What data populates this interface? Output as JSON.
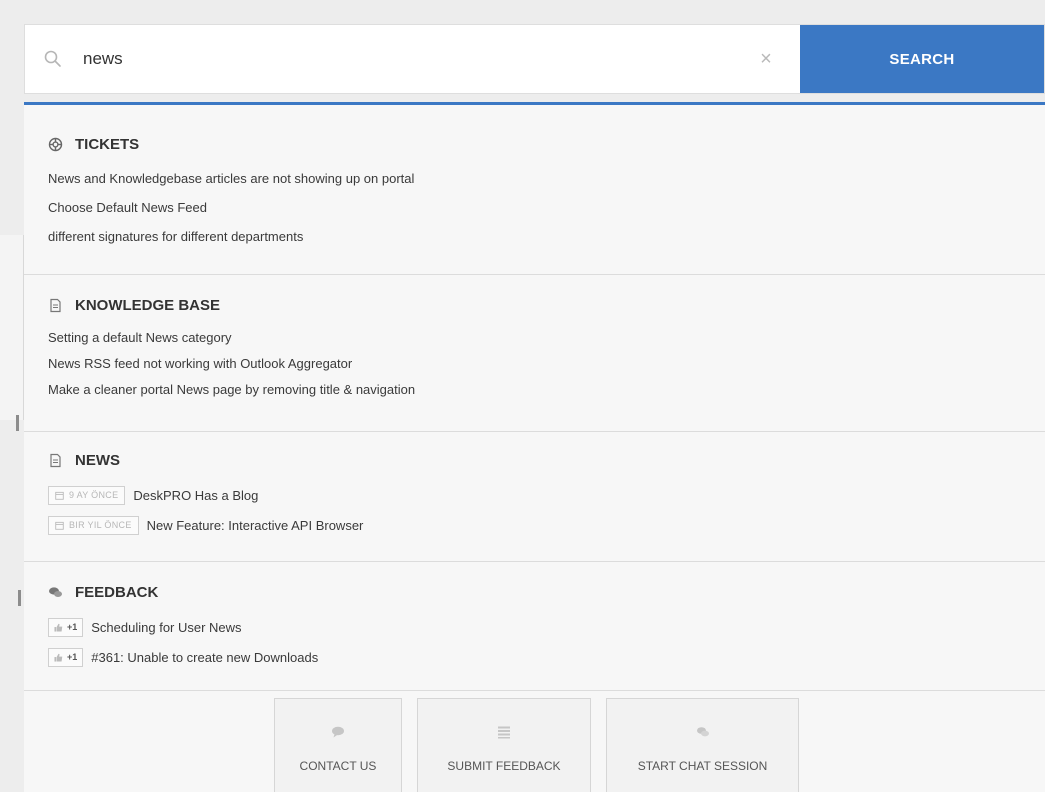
{
  "search": {
    "value": "news",
    "button_label": "SEARCH"
  },
  "sections": {
    "tickets": {
      "title": "TICKETS",
      "items": [
        "News and Knowledgebase articles are not showing up on portal",
        "Choose Default News Feed",
        "different signatures for different departments"
      ]
    },
    "knowledge_base": {
      "title": "KNOWLEDGE BASE",
      "items": [
        "Setting a default News category",
        "News RSS feed not working with Outlook Aggregator",
        "Make a cleaner portal News page by removing title & navigation"
      ]
    },
    "news": {
      "title": "NEWS",
      "items": [
        {
          "date": "9 AY ÖNCE",
          "title": "DeskPRO Has a Blog"
        },
        {
          "date": "BIR YIL ÖNCE",
          "title": "New Feature: Interactive API Browser"
        }
      ]
    },
    "feedback": {
      "title": "FEEDBACK",
      "items": [
        {
          "votes": "+1",
          "title": "Scheduling for User News"
        },
        {
          "votes": "+1",
          "title": "#361: Unable to create new Downloads"
        }
      ]
    }
  },
  "actions": {
    "contact_us": "CONTACT US",
    "submit_feedback": "SUBMIT FEEDBACK",
    "start_chat": "START CHAT SESSION"
  },
  "colors": {
    "accent": "#3b78c4",
    "panel_bg": "#f7f7f7"
  }
}
